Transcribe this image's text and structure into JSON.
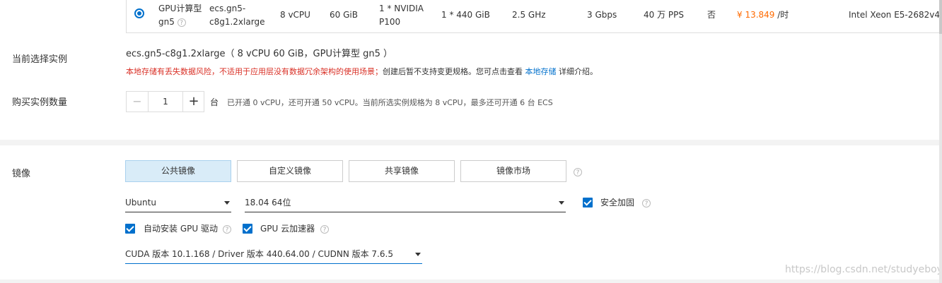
{
  "instance_row": {
    "family_line1": "GPU计算型",
    "family_line2": "gn5",
    "spec_line1": "ecs.gn5-",
    "spec_line2": "c8g1.2xlarge",
    "vcpu": "8 vCPU",
    "memory": "60 GiB",
    "gpu_line1": "1 * NVIDIA",
    "gpu_line2": "P100",
    "local_disk": "1 * 440 GiB",
    "clock": "2.5 GHz",
    "bandwidth": "3 Gbps",
    "pps": "40 万 PPS",
    "ipv6": "否",
    "price": "¥ 13.849",
    "price_unit": " /时",
    "processor": "Intel Xeon E5-2682v4"
  },
  "current_instance": {
    "label": "当前选择实例",
    "value": "ecs.gn5-c8g1.2xlarge（ 8 vCPU 60 GiB，GPU计算型 gn5 ）",
    "warning": "本地存储有丢失数据风险，不适用于应用层没有数据冗余架构的使用场景；",
    "note": "创建后暂不支持变更规格。您可点击查看",
    "link": "本地存储",
    "note_tail": "详细介绍。"
  },
  "quantity": {
    "label": "购买实例数量",
    "minus": "−",
    "value": "1",
    "plus": "+",
    "unit": "台",
    "hint": "已开通 0 vCPU，还可开通 50 vCPU。当前所选实例规格为 8 vCPU，最多还可开通 6 台 ECS"
  },
  "image": {
    "label": "镜像",
    "tabs": [
      "公共镜像",
      "自定义镜像",
      "共享镜像",
      "镜像市场"
    ],
    "help": "?",
    "os": "Ubuntu",
    "version": "18.04 64位",
    "security_label": "安全加固",
    "auto_gpu_driver": "自动安装 GPU 驱动",
    "gpu_accelerator": "GPU 云加速器",
    "cuda": "CUDA 版本 10.1.168 / Driver 版本 440.64.00 / CUDNN 版本 7.6.5"
  },
  "watermark": "https://blog.csdn.net/studyeboy",
  "colors": {
    "accent": "#0070cc",
    "warning": "#d93026",
    "price": "#ff6a00"
  }
}
